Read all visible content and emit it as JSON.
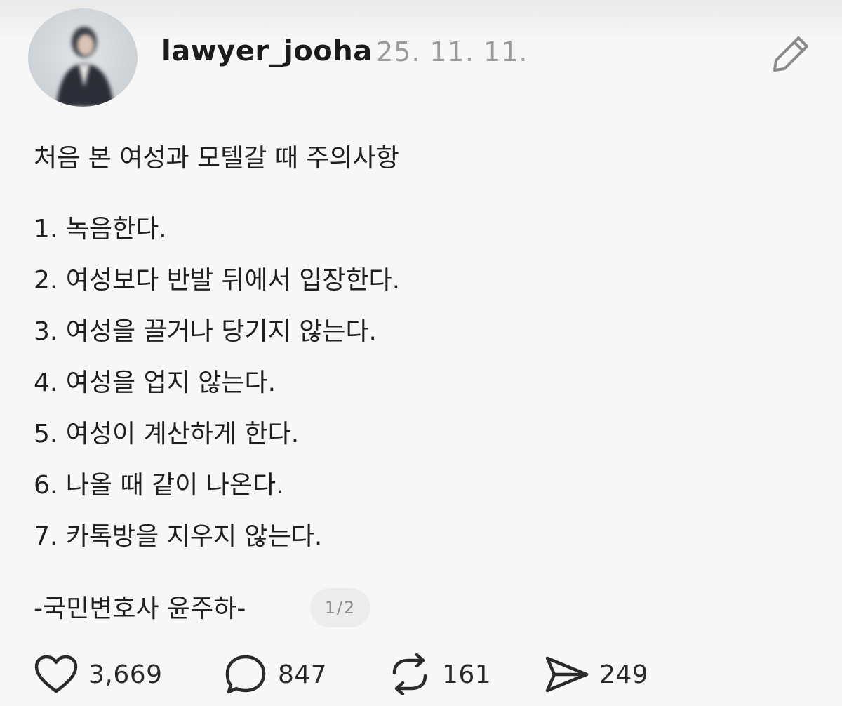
{
  "header": {
    "username": "lawyer_jooha",
    "date": "25. 11. 11."
  },
  "icons": {
    "avatar": "profile-photo",
    "edit": "pencil-icon",
    "like": "heart-icon",
    "reply": "speech-bubble-icon",
    "repost": "repost-arrows-icon",
    "share": "paper-plane-icon"
  },
  "post": {
    "title": "처음 본 여성과 모텔갈 때 주의사항",
    "items": [
      "1. 녹음한다.",
      "2. 여성보다 반발 뒤에서 입장한다.",
      "3. 여성을 끌거나 당기지 않는다.",
      "4. 여성을 업지 않는다.",
      "5. 여성이 계산하게 한다.",
      "6. 나올 때 같이 나온다.",
      "7. 카톡방을 지우지 않는다."
    ],
    "signature": "-국민변호사 윤주하-",
    "page_indicator": "1/2"
  },
  "actions": {
    "likes": "3,669",
    "replies": "847",
    "reposts": "161",
    "shares": "249"
  }
}
